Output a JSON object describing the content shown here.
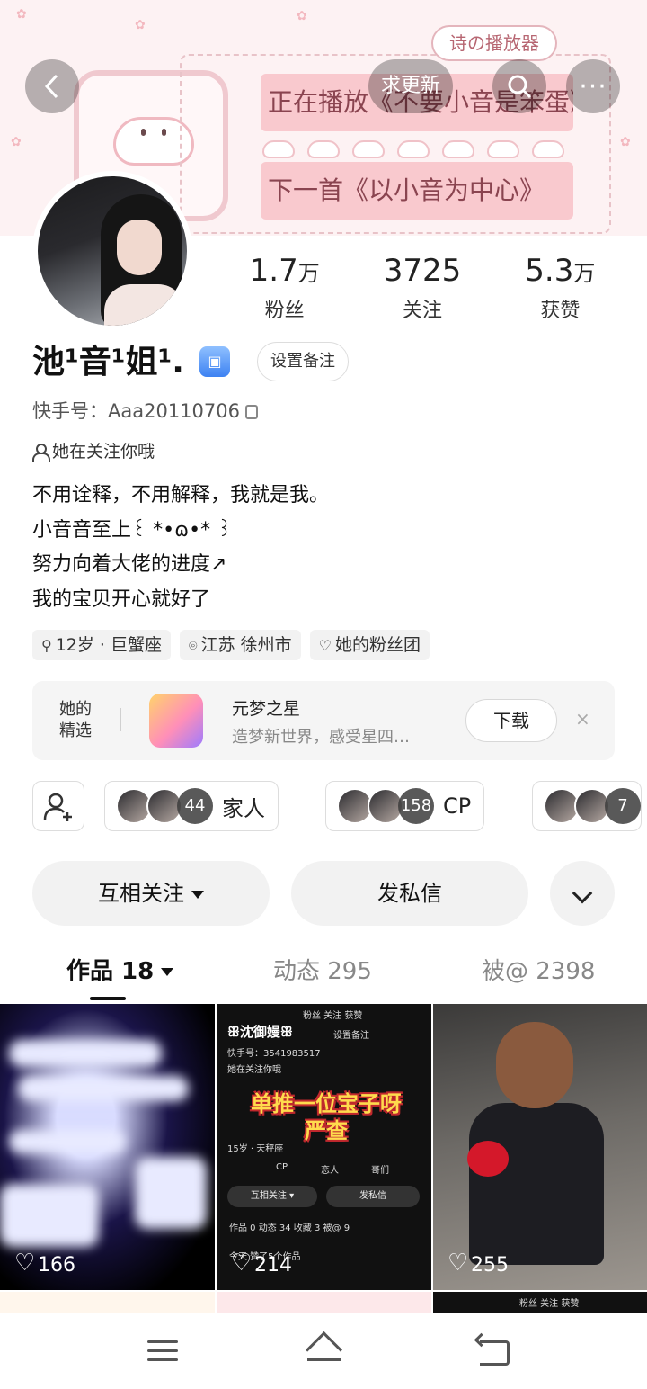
{
  "banner": {
    "player_tag": "诗の播放器",
    "now_playing": "正在播放《不要小音是笨蛋》",
    "next_song": "下一首《以小音为中心》"
  },
  "top_bar": {
    "update_request": "求更新"
  },
  "stats": [
    {
      "value": "1.7",
      "unit": "万",
      "label": "粉丝"
    },
    {
      "value": "3725",
      "unit": "",
      "label": "关注"
    },
    {
      "value": "5.3",
      "unit": "万",
      "label": "获赞"
    }
  ],
  "profile": {
    "nickname": "池¹音¹姐¹.",
    "remark_button": "设置备注",
    "kuaishou_id": "快手号：Aaa20110706",
    "follows_you": "她在关注你哦",
    "bio": [
      "不用诠释，不用解释，我就是我。",
      "小音音至上꒰ *•ɷ•* ꒱",
      "努力向着大佬的进度↗",
      "我的宝贝开心就好了"
    ],
    "tags": [
      {
        "icon": "gender-icon",
        "text": "12岁 · 巨蟹座"
      },
      {
        "icon": "location-icon",
        "text": "江苏 徐州市"
      },
      {
        "icon": "fan-club-icon",
        "text": "她的粉丝团"
      }
    ]
  },
  "featured": {
    "label": "她的精选",
    "app_name": "元梦之星",
    "app_desc": "造梦新世界，感受星四…",
    "download": "下载",
    "close": "×"
  },
  "circles": [
    {
      "count": "44",
      "name": "家人"
    },
    {
      "count": "158",
      "name": "CP"
    },
    {
      "count": "7",
      "name": ""
    }
  ],
  "actions": {
    "follow": "互相关注",
    "message": "发私信"
  },
  "tabs": [
    {
      "label": "作品 18",
      "active": true
    },
    {
      "label": "动态 295",
      "active": false
    },
    {
      "label": "被@ 2398",
      "active": false
    }
  ],
  "works": [
    {
      "likes": "166"
    },
    {
      "likes": "214"
    },
    {
      "likes": "255"
    }
  ],
  "work2_screenshot": {
    "title": "ꕥ沈御嫚ꕥ",
    "stats": "粉丝    关注    获赞",
    "id": "快手号：3541983517",
    "remark": "设置备注",
    "follows": "她在关注你哦",
    "overlay_line1": "单推一位宝子呀",
    "overlay_line2": "严查",
    "tag": "15岁 · 天秤座",
    "chip_cp": "CP",
    "chip_lovers": "恋人",
    "chip_brothers": "哥们",
    "btn_follow": "互相关注 ▾",
    "btn_msg": "发私信",
    "tabs": "作品 0     动态 34     收藏 3     被@ 9",
    "footer": "今天    赞了5个作品"
  },
  "row2_text": "粉丝    关注    获赞"
}
